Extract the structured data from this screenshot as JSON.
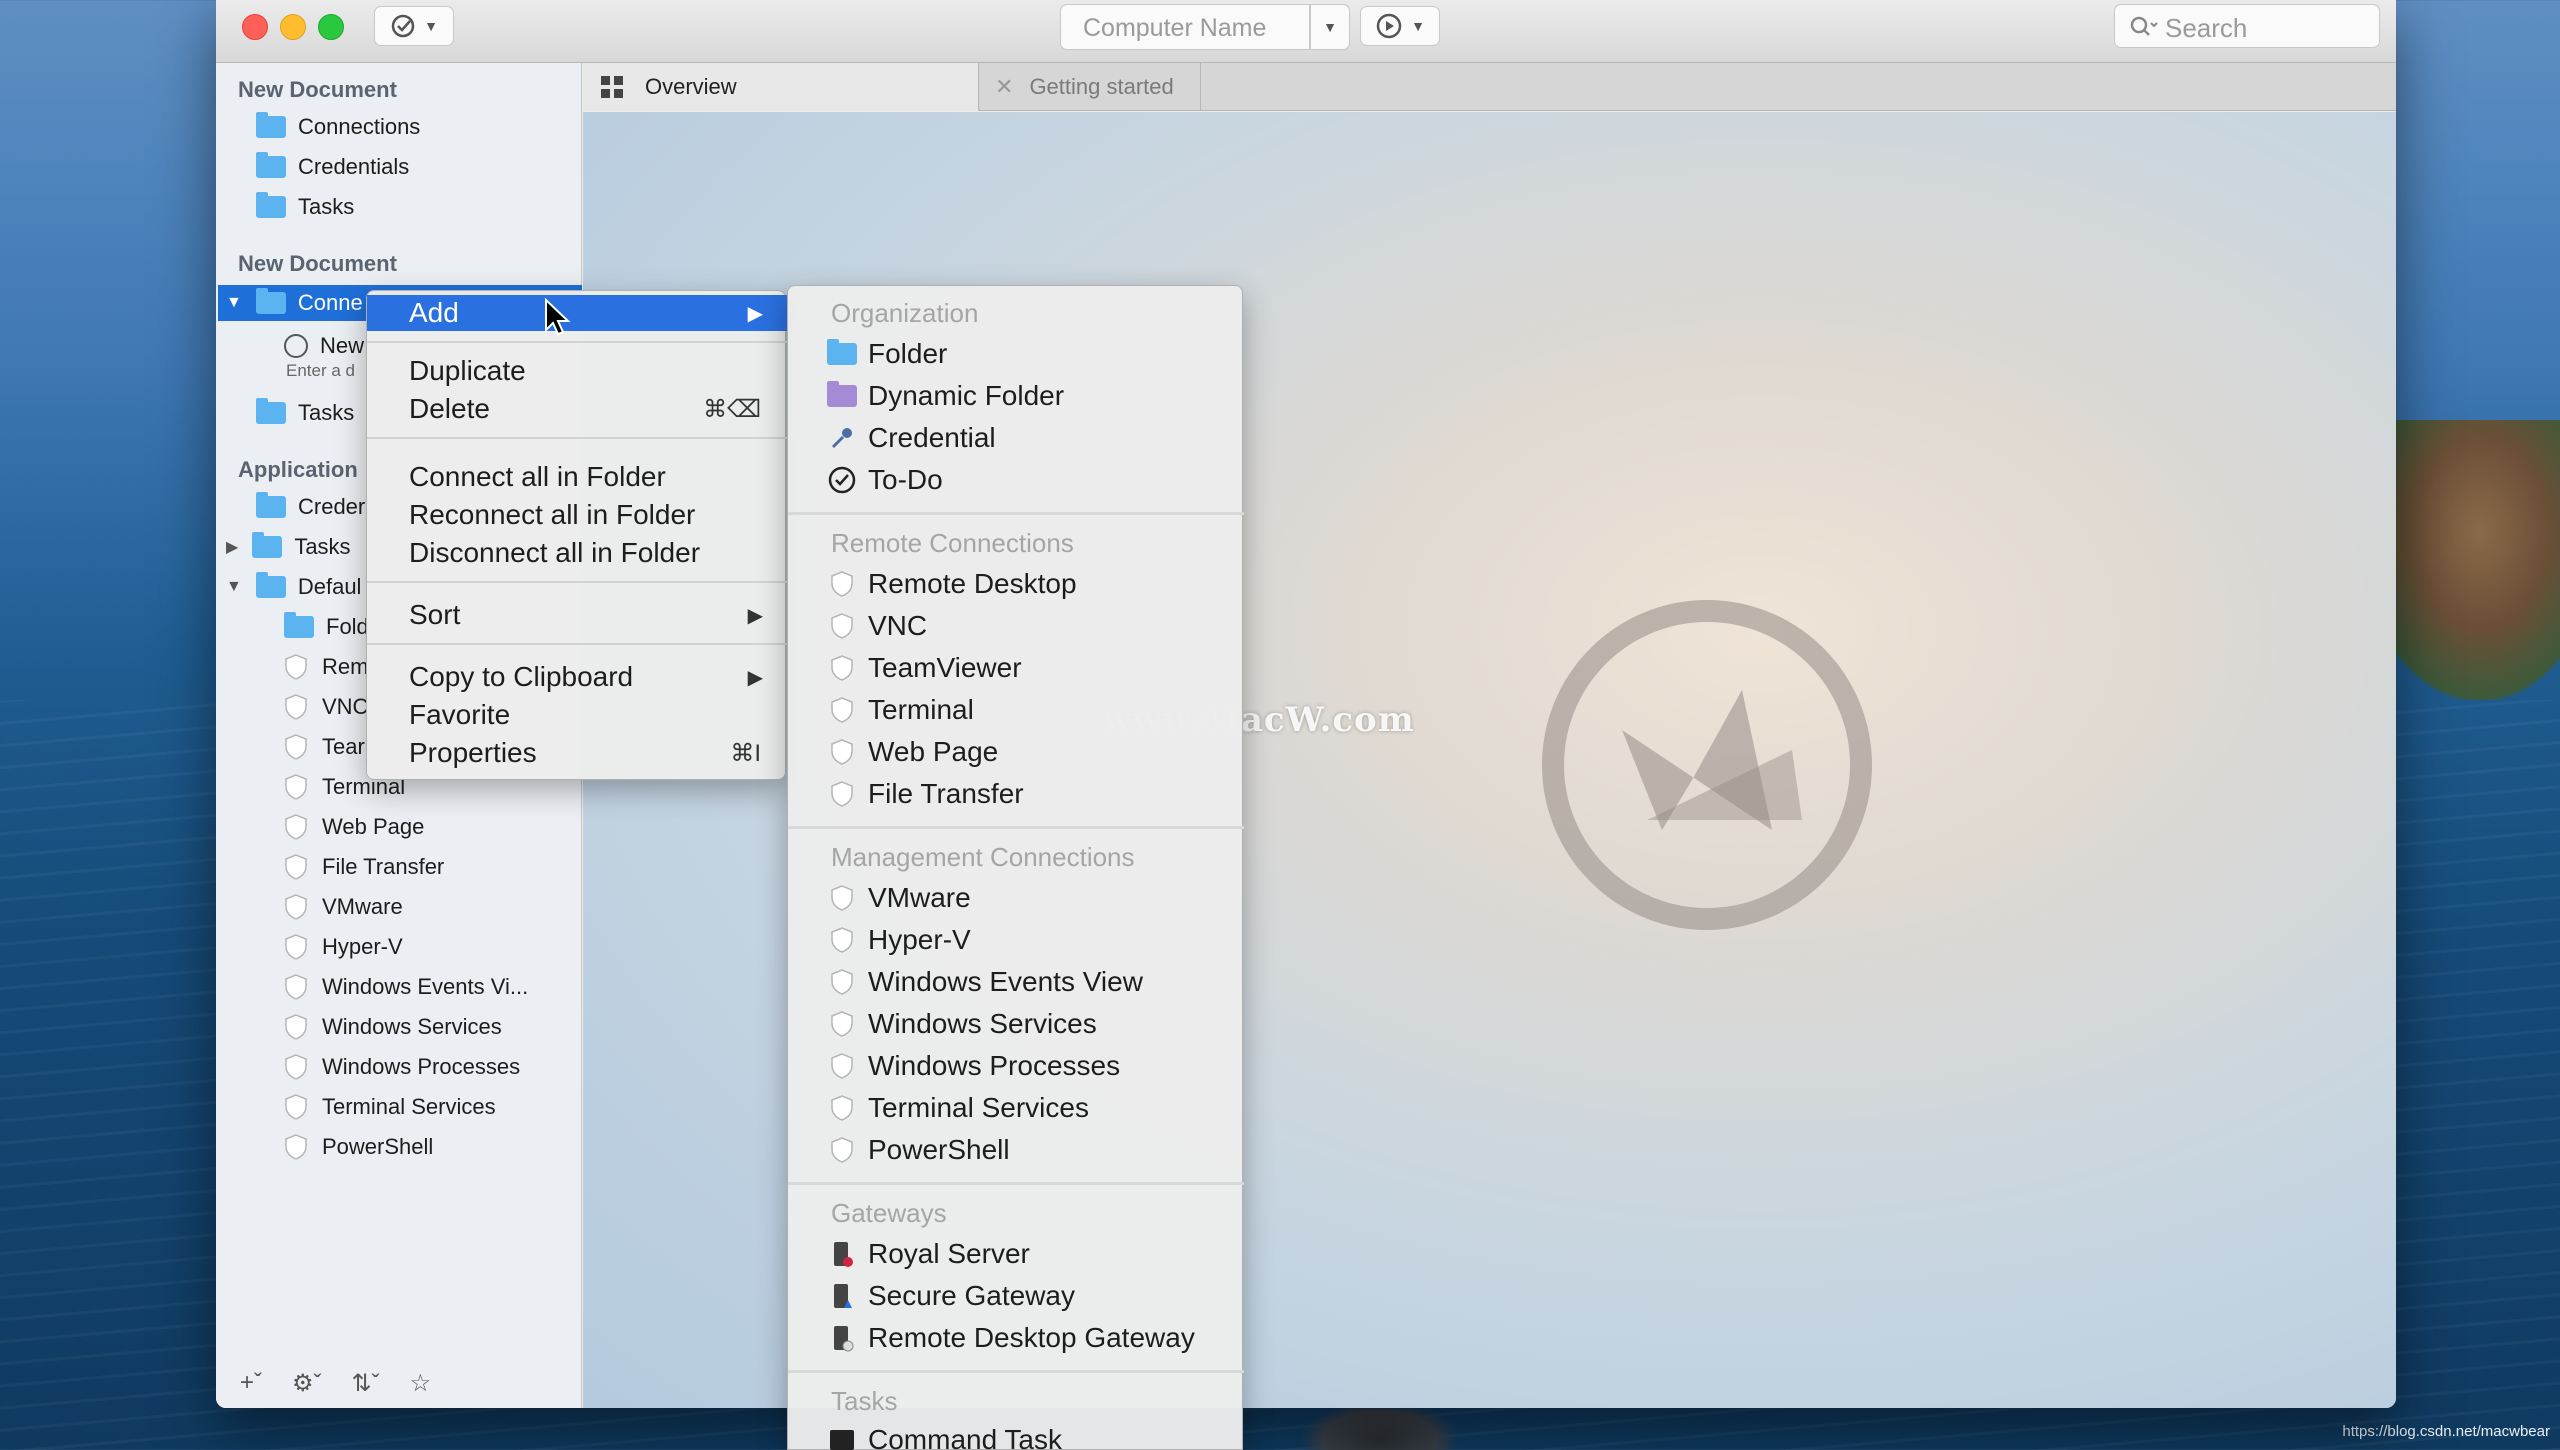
{
  "toolbar": {
    "computer_name_placeholder": "Computer Name",
    "search_placeholder": "Search"
  },
  "sidebar": {
    "section1_title": "New Document",
    "section1_items": [
      "Connections",
      "Credentials",
      "Tasks"
    ],
    "section2_title": "New Document",
    "section2_selected": "Conne",
    "section2_new": "New",
    "section2_hint": "Enter a d",
    "section2_tasks": "Tasks",
    "section3_title": "Application",
    "section3_items": [
      "Creder",
      "Tasks",
      "Defaul"
    ],
    "default_children": [
      "Fold",
      "Rem",
      "VNC",
      "Tear",
      "Terminal",
      "Web Page",
      "File Transfer",
      "VMware",
      "Hyper-V",
      "Windows Events Vi...",
      "Windows Services",
      "Windows Processes",
      "Terminal Services",
      "PowerShell"
    ]
  },
  "tabs": [
    {
      "label": "Overview"
    },
    {
      "label": "Getting started"
    }
  ],
  "context_menu": {
    "add": "Add",
    "duplicate": "Duplicate",
    "delete": "Delete",
    "delete_shortcut": "⌘⌫",
    "connect_all": "Connect all in Folder",
    "reconnect_all": "Reconnect all in Folder",
    "disconnect_all": "Disconnect all in Folder",
    "sort": "Sort",
    "copy": "Copy to Clipboard",
    "favorite": "Favorite",
    "properties": "Properties",
    "properties_shortcut": "⌘I"
  },
  "submenu": {
    "organization_title": "Organization",
    "organization": [
      "Folder",
      "Dynamic Folder",
      "Credential",
      "To-Do"
    ],
    "remote_title": "Remote Connections",
    "remote": [
      "Remote Desktop",
      "VNC",
      "TeamViewer",
      "Terminal",
      "Web Page",
      "File Transfer"
    ],
    "management_title": "Management Connections",
    "management": [
      "VMware",
      "Hyper-V",
      "Windows Events View",
      "Windows Services",
      "Windows Processes",
      "Terminal Services",
      "PowerShell"
    ],
    "gateways_title": "Gateways",
    "gateways": [
      "Royal Server",
      "Secure Gateway",
      "Remote Desktop Gateway"
    ],
    "tasks_title": "Tasks",
    "tasks": [
      "Command Task"
    ]
  },
  "watermark_text": "www.MacW.com",
  "footer_url": "https://blog.csdn.net/macwbear",
  "colors": {
    "selection": "#2b70e0",
    "folder": "#5bb4f0",
    "traffic_red": "#fe5f57",
    "traffic_yellow": "#febc2e",
    "traffic_green": "#28c840"
  }
}
